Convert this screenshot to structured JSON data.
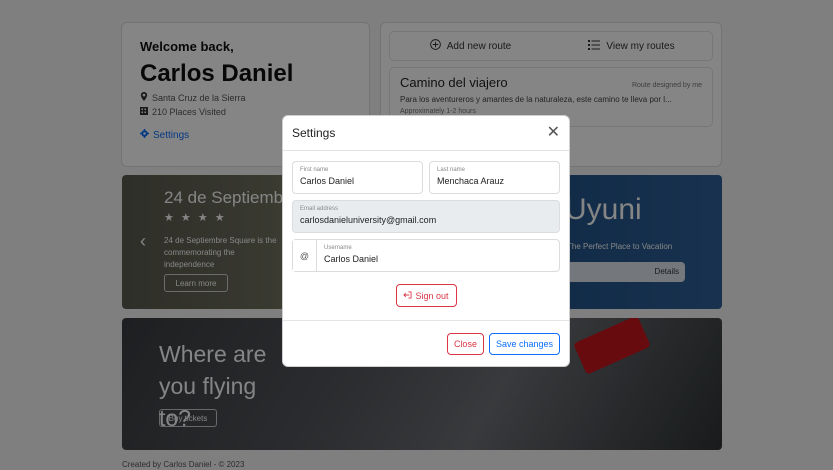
{
  "welcome": {
    "greeting": "Welcome back,",
    "name": "Carlos Daniel",
    "location": "Santa Cruz de la Sierra",
    "places": "210 Places Visited",
    "settings_link": "Settings"
  },
  "routes": {
    "add_label": "Add new route",
    "view_label": "View my routes",
    "card_title": "Camino del viajero",
    "card_by": "Route designed by me",
    "card_desc": "Para los aventureros y amantes de la naturaleza, este camino te lleva por l...",
    "card_time": "Approximately 1-2 hours"
  },
  "carousel": {
    "title": "24 de Septiembre",
    "stars": "★ ★ ★ ★",
    "text": "24 de Septiembre Square is the commemorating the independence",
    "learn_more": "Learn more",
    "uyuni_title": "Uyuni",
    "uyuni_sub": "The Perfect Place to Vacation",
    "uyuni_btn": "Details"
  },
  "flight": {
    "title": "Where are you flying to?",
    "button": "Buy tickets"
  },
  "footer": {
    "text": "Created by Carlos Daniel - © 2023"
  },
  "modal": {
    "title": "Settings",
    "close_glyph": "✕",
    "first_name_label": "First name",
    "first_name_value": "Carlos Daniel",
    "last_name_label": "Last name",
    "last_name_value": "Menchaca Arauz",
    "email_label": "Email address",
    "email_value": "carlosdanieluniversity@gmail.com",
    "username_prefix": "@",
    "username_label": "Username",
    "username_value": "Carlos Daniel",
    "sign_out": "Sign out",
    "close_btn": "Close",
    "save_btn": "Save changes"
  },
  "colors": {
    "primary": "#0d6efd",
    "danger": "#dc3545"
  },
  "icons": [
    "plus-circle-icon",
    "list-icon",
    "map-pin-icon",
    "building-icon",
    "gear-icon",
    "chevron-left-icon",
    "sign-out-icon",
    "close-icon"
  ]
}
